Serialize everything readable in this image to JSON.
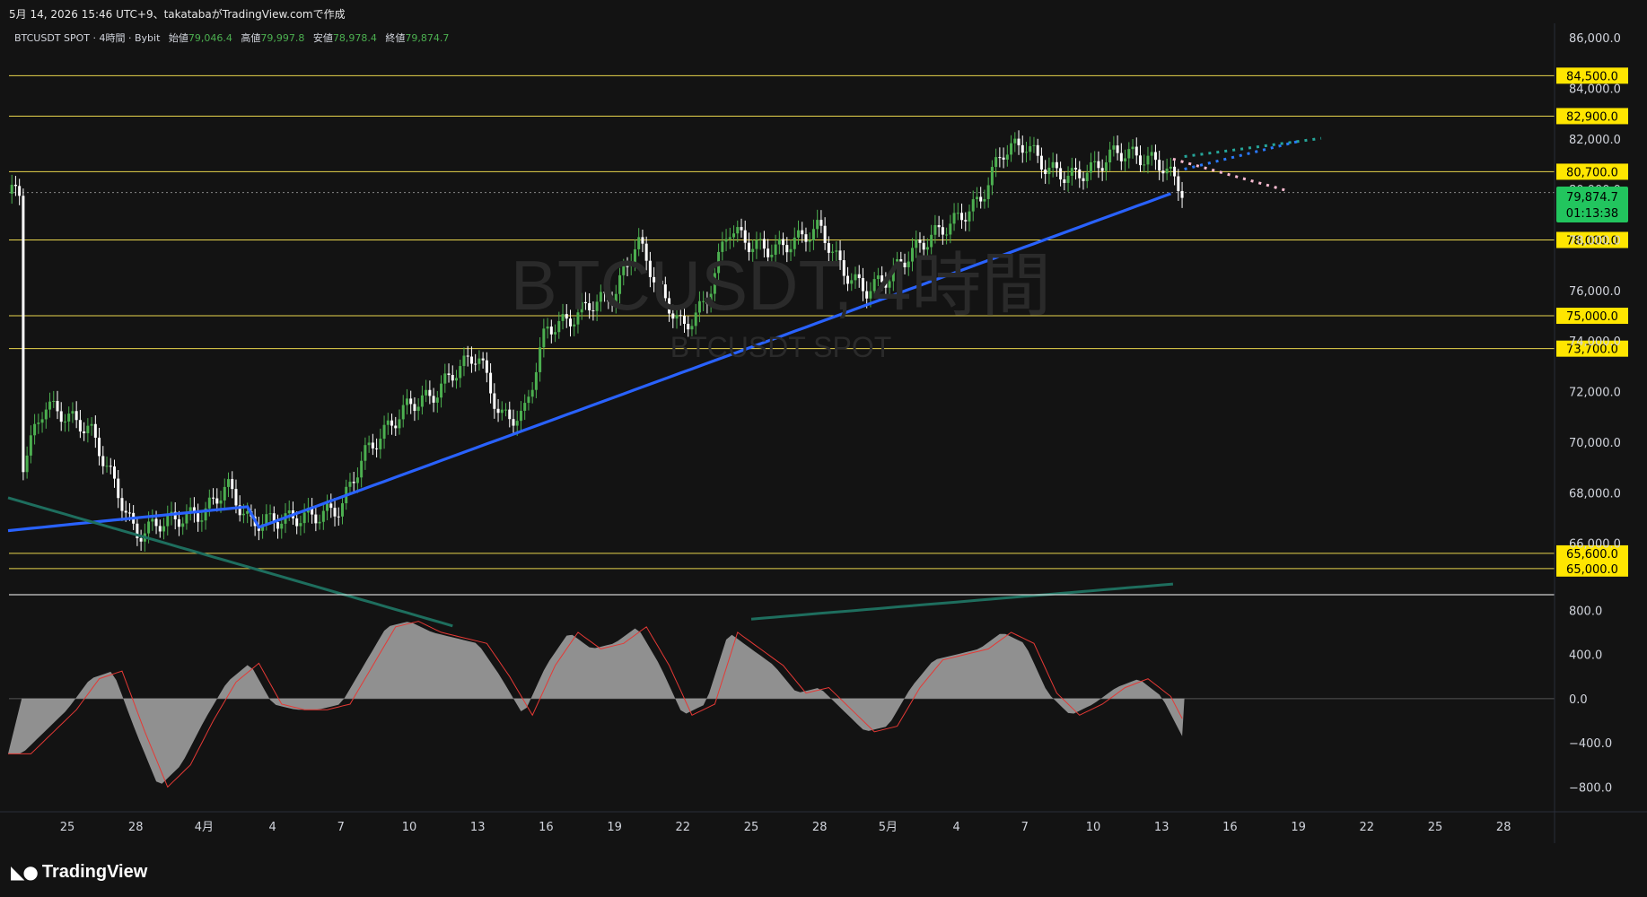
{
  "header": {
    "caption": "5月 14, 2026 15:46 UTC+9、takatabaがTradingView.comで作成"
  },
  "legend": {
    "symbol": "BTCUSDT SPOT · 4時間 · Bybit",
    "open_label": "始値",
    "open": "79,046.4",
    "high_label": "高値",
    "high": "79,997.8",
    "low_label": "安値",
    "low": "78,978.4",
    "close_label": "終値",
    "close": "79,874.7"
  },
  "watermark": {
    "main": "BTCUSDT, 4時間",
    "sub": "BTCUSDT SPOT"
  },
  "price_badge": {
    "price": "79,874.7",
    "countdown": "01:13:38"
  },
  "footer": {
    "brand": "TradingView"
  },
  "colors": {
    "background": "#131313",
    "up": "#4caf50",
    "down": "#ffffff",
    "level_line": "#e8d44d",
    "level_label_bg": "#ffe600",
    "price_badge_bg": "#22c55e",
    "ma_blue": "#2962ff",
    "ma_pink": "#f8bbd0",
    "ma_green": "#81c784",
    "bollinger": "#2f6bd8",
    "macd_hist": "#9e9e9e",
    "macd_signal": "#e53935"
  },
  "chart_data": [
    {
      "type": "candlestick",
      "ylim": [
        64000,
        86500
      ],
      "y_ticks": [
        "86,000.0",
        "84,000.0",
        "82,000.0",
        "80,000.0",
        "78,000.0",
        "76,000.0",
        "74,000.0",
        "72,000.0",
        "70,000.0",
        "68,000.0",
        "66,000.0"
      ],
      "x_ticks": [
        "25",
        "28",
        "4月",
        "4",
        "7",
        "10",
        "13",
        "16",
        "19",
        "22",
        "25",
        "28",
        "5月",
        "4",
        "7",
        "10",
        "13",
        "16",
        "19",
        "22",
        "25",
        "28"
      ],
      "horizontal_levels": [
        {
          "value": 84500,
          "label": "84,500.0"
        },
        {
          "value": 82900,
          "label": "82,900.0"
        },
        {
          "value": 80700,
          "label": "80,700.0"
        },
        {
          "value": 78000,
          "label": "78,000.0"
        },
        {
          "value": 75000,
          "label": "75,000.0"
        },
        {
          "value": 73700,
          "label": "73,700.0"
        },
        {
          "value": 65600,
          "label": "65,600.0"
        },
        {
          "value": 65000,
          "label": "65,000.0"
        }
      ],
      "current_price": 79874.7,
      "price_path": [
        {
          "day": -2,
          "v": 69000
        },
        {
          "day": -1,
          "v": 71500
        },
        {
          "day": 0,
          "v": 71000
        },
        {
          "day": 1,
          "v": 70500
        },
        {
          "day": 2,
          "v": 68500
        },
        {
          "day": 3,
          "v": 66300
        },
        {
          "day": 4,
          "v": 66800
        },
        {
          "day": 5,
          "v": 67000
        },
        {
          "day": 6,
          "v": 67200
        },
        {
          "day": 7,
          "v": 68300
        },
        {
          "day": 8,
          "v": 66800
        },
        {
          "day": 9,
          "v": 66900
        },
        {
          "day": 10,
          "v": 67000
        },
        {
          "day": 11,
          "v": 67100
        },
        {
          "day": 12,
          "v": 67400
        },
        {
          "day": 13,
          "v": 69500
        },
        {
          "day": 14,
          "v": 70500
        },
        {
          "day": 15,
          "v": 71500
        },
        {
          "day": 16,
          "v": 71800
        },
        {
          "day": 17,
          "v": 72800
        },
        {
          "day": 18,
          "v": 73500
        },
        {
          "day": 19,
          "v": 71000
        },
        {
          "day": 20,
          "v": 71000
        },
        {
          "day": 21,
          "v": 74500
        },
        {
          "day": 22,
          "v": 74800
        },
        {
          "day": 23,
          "v": 75500
        },
        {
          "day": 24,
          "v": 75800
        },
        {
          "day": 25,
          "v": 78000
        },
        {
          "day": 26,
          "v": 76000
        },
        {
          "day": 27,
          "v": 74500
        },
        {
          "day": 28,
          "v": 75500
        },
        {
          "day": 29,
          "v": 78500
        },
        {
          "day": 30,
          "v": 77800
        },
        {
          "day": 31,
          "v": 77600
        },
        {
          "day": 32,
          "v": 78000
        },
        {
          "day": 33,
          "v": 78500
        },
        {
          "day": 34,
          "v": 76800
        },
        {
          "day": 35,
          "v": 76000
        },
        {
          "day": 36,
          "v": 76500
        },
        {
          "day": 37,
          "v": 77500
        },
        {
          "day": 38,
          "v": 78200
        },
        {
          "day": 39,
          "v": 78800
        },
        {
          "day": 40,
          "v": 79500
        },
        {
          "day": 41,
          "v": 81500
        },
        {
          "day": 42,
          "v": 81800
        },
        {
          "day": 43,
          "v": 80800
        },
        {
          "day": 44,
          "v": 80500
        },
        {
          "day": 45,
          "v": 80800
        },
        {
          "day": 46,
          "v": 81500
        },
        {
          "day": 47,
          "v": 81300
        },
        {
          "day": 48,
          "v": 81000
        },
        {
          "day": 49,
          "v": 79874.7
        }
      ]
    },
    {
      "type": "macd",
      "ylim": [
        -1000,
        900
      ],
      "y_ticks": [
        "800.0",
        "400.0",
        "0.0",
        "−400.0",
        "−800.0"
      ],
      "histogram": [
        {
          "day": -2,
          "v": -500
        },
        {
          "day": 0,
          "v": -100
        },
        {
          "day": 1,
          "v": 180
        },
        {
          "day": 2,
          "v": 250
        },
        {
          "day": 3,
          "v": -300
        },
        {
          "day": 4,
          "v": -800
        },
        {
          "day": 5,
          "v": -600
        },
        {
          "day": 6,
          "v": -200
        },
        {
          "day": 7,
          "v": 150
        },
        {
          "day": 8,
          "v": 320
        },
        {
          "day": 9,
          "v": -50
        },
        {
          "day": 10,
          "v": -100
        },
        {
          "day": 11,
          "v": -100
        },
        {
          "day": 12,
          "v": -50
        },
        {
          "day": 13,
          "v": 300
        },
        {
          "day": 14,
          "v": 650
        },
        {
          "day": 15,
          "v": 700
        },
        {
          "day": 16,
          "v": 600
        },
        {
          "day": 17,
          "v": 550
        },
        {
          "day": 18,
          "v": 500
        },
        {
          "day": 19,
          "v": 200
        },
        {
          "day": 20,
          "v": -150
        },
        {
          "day": 21,
          "v": 300
        },
        {
          "day": 22,
          "v": 600
        },
        {
          "day": 23,
          "v": 450
        },
        {
          "day": 24,
          "v": 500
        },
        {
          "day": 25,
          "v": 650
        },
        {
          "day": 26,
          "v": 300
        },
        {
          "day": 27,
          "v": -150
        },
        {
          "day": 28,
          "v": -50
        },
        {
          "day": 29,
          "v": 600
        },
        {
          "day": 30,
          "v": 450
        },
        {
          "day": 31,
          "v": 300
        },
        {
          "day": 32,
          "v": 50
        },
        {
          "day": 33,
          "v": 100
        },
        {
          "day": 34,
          "v": -100
        },
        {
          "day": 35,
          "v": -300
        },
        {
          "day": 36,
          "v": -250
        },
        {
          "day": 37,
          "v": 100
        },
        {
          "day": 38,
          "v": 350
        },
        {
          "day": 39,
          "v": 400
        },
        {
          "day": 40,
          "v": 450
        },
        {
          "day": 41,
          "v": 600
        },
        {
          "day": 42,
          "v": 500
        },
        {
          "day": 43,
          "v": 50
        },
        {
          "day": 44,
          "v": -150
        },
        {
          "day": 45,
          "v": -50
        },
        {
          "day": 46,
          "v": 100
        },
        {
          "day": 47,
          "v": 180
        },
        {
          "day": 48,
          "v": 20
        },
        {
          "day": 49,
          "v": -380
        }
      ]
    }
  ]
}
